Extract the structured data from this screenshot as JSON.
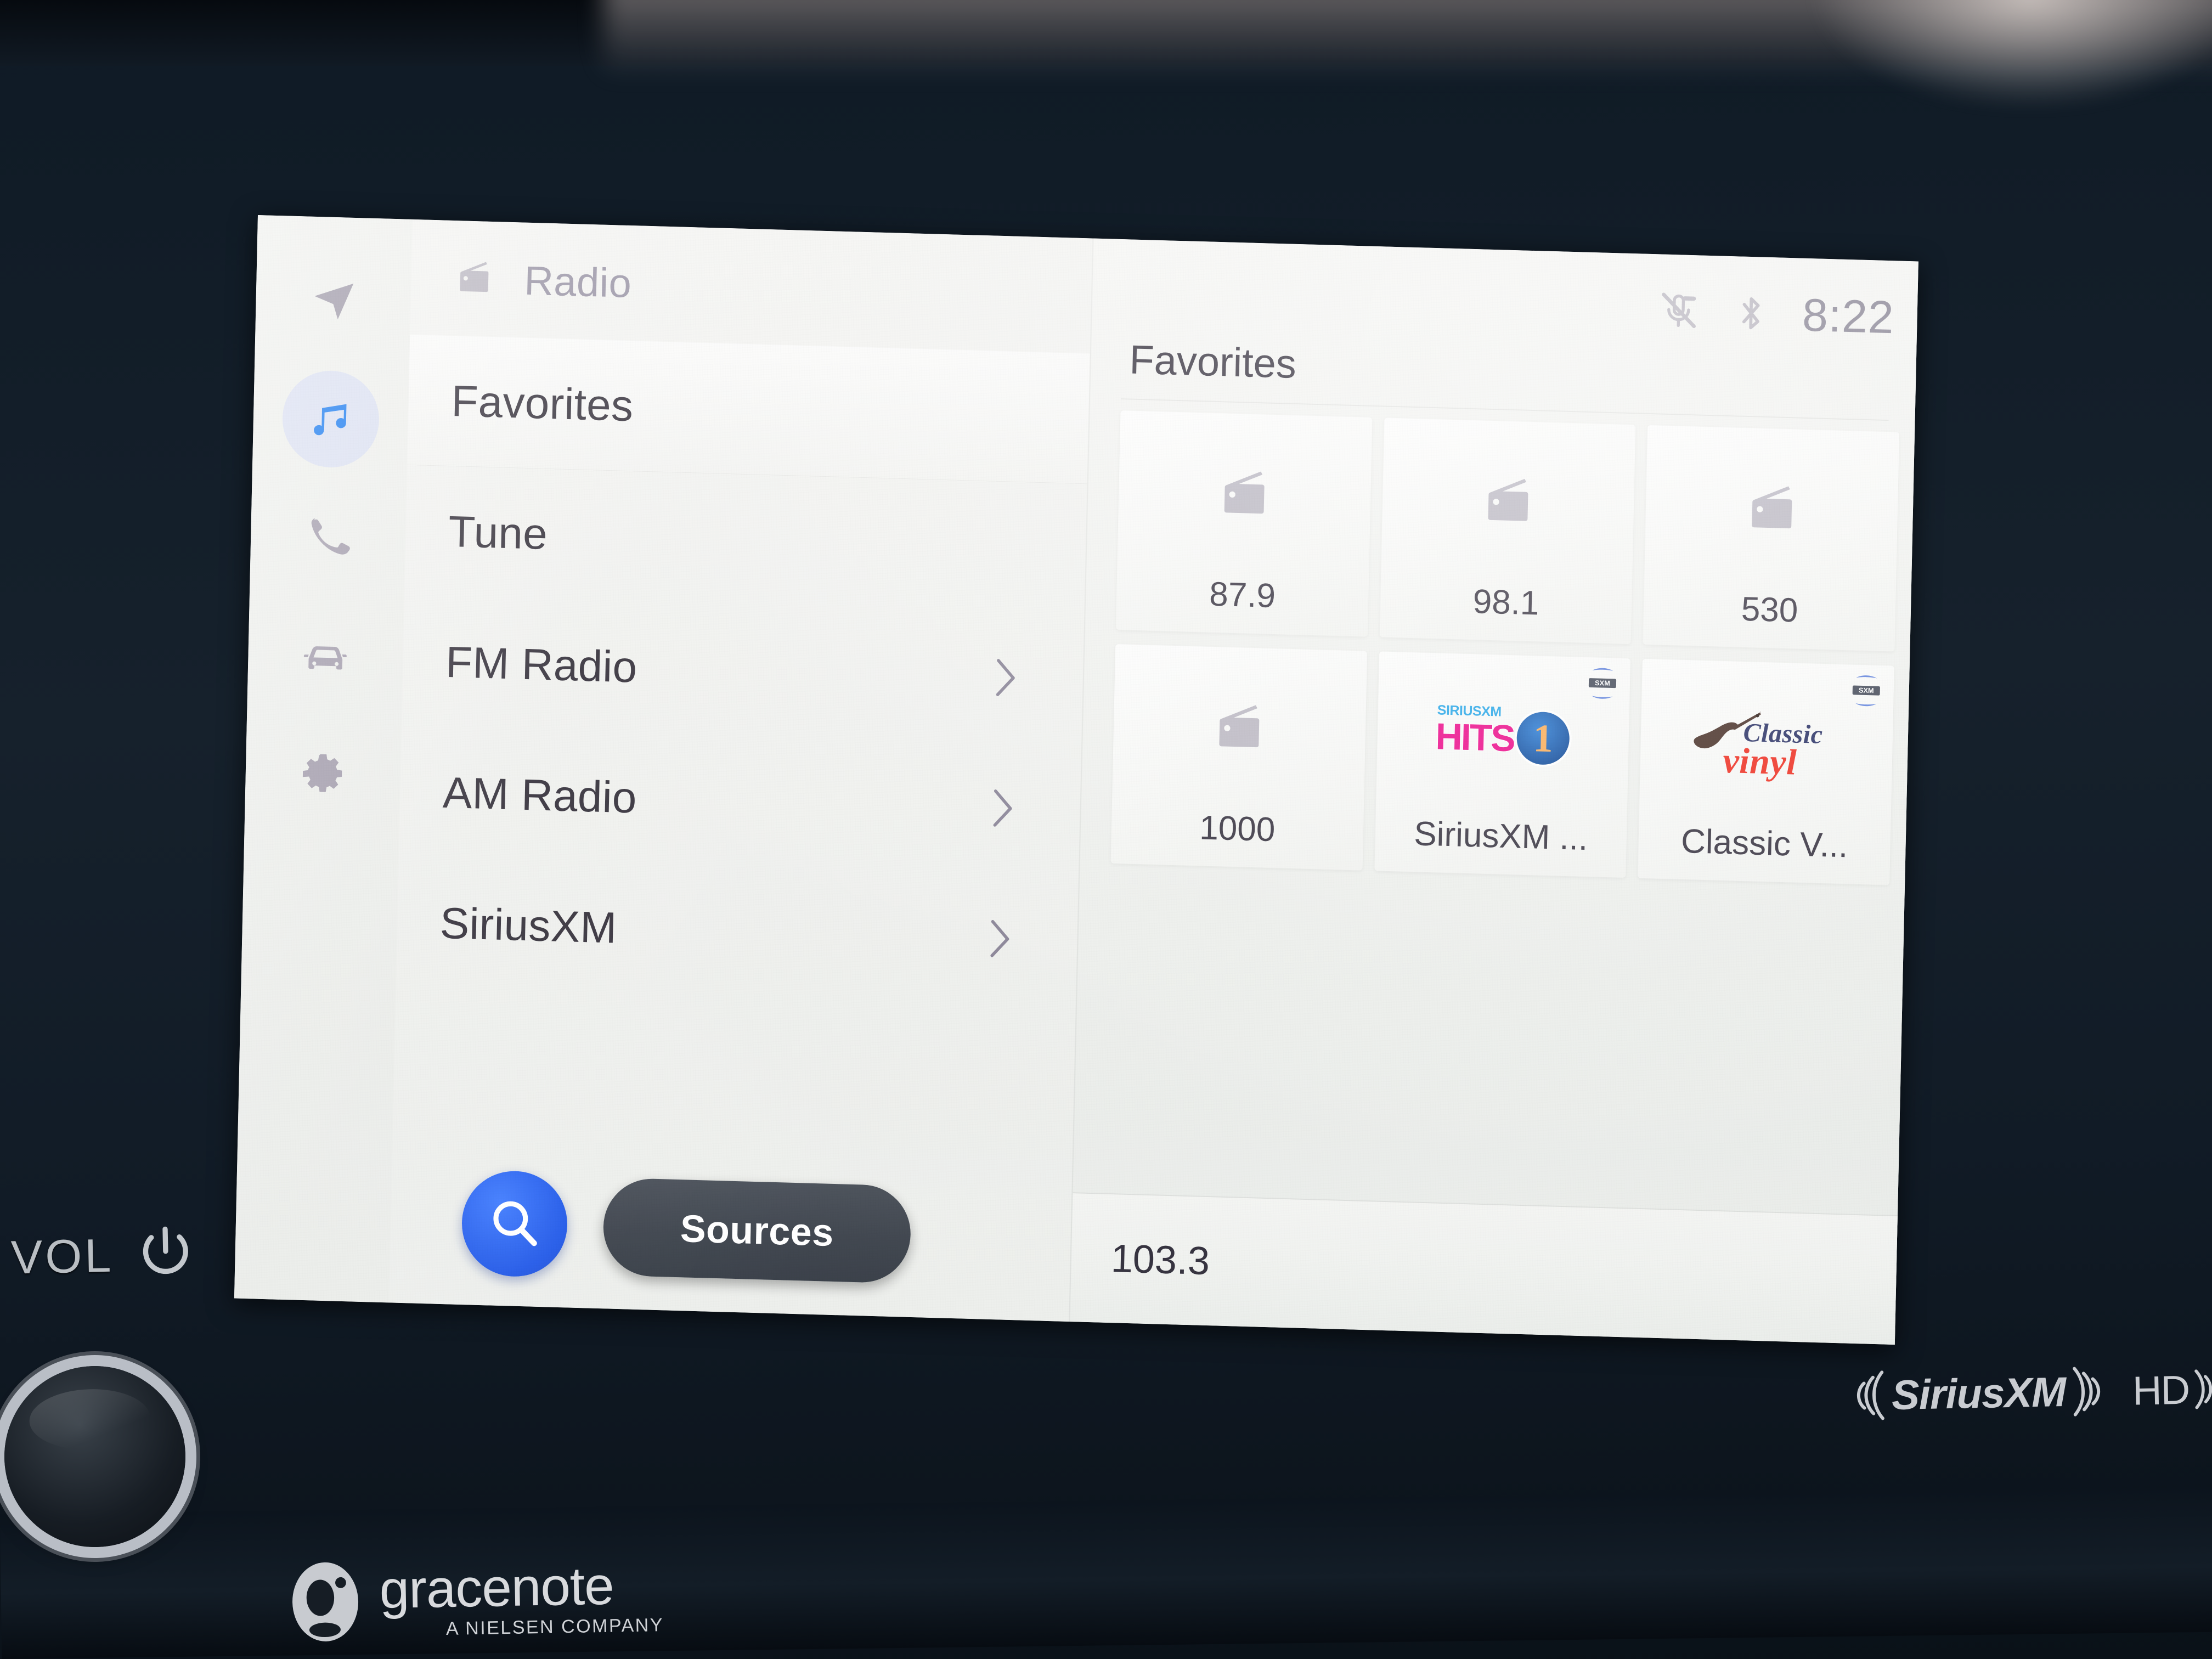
{
  "device": {
    "hardware_labels": {
      "volume": "VOL",
      "power_icon": "power-icon",
      "volume_knob": "volume-knob"
    },
    "branding": {
      "gracenote_name": "gracenote",
      "gracenote_tagline": "A NIELSEN COMPANY",
      "siriusxm_brand": "SiriusXM",
      "hd_radio_brand": "HD"
    }
  },
  "rail": {
    "items": [
      {
        "name": "navigation",
        "icon": "navigation-arrow-icon",
        "selected": false
      },
      {
        "name": "media",
        "icon": "music-note-icon",
        "selected": true
      },
      {
        "name": "phone",
        "icon": "phone-icon",
        "selected": false
      },
      {
        "name": "vehicle",
        "icon": "car-icon",
        "selected": false
      },
      {
        "name": "settings",
        "icon": "gear-icon",
        "selected": false
      }
    ],
    "accent_color": "#1e56e8",
    "selected_pill_color": "#d9dff2"
  },
  "list_panel": {
    "header": {
      "icon": "radio-icon",
      "title": "Radio"
    },
    "items": [
      {
        "label": "Favorites",
        "selected": true,
        "chevron": false
      },
      {
        "label": "Tune",
        "selected": false,
        "chevron": false
      },
      {
        "label": "FM Radio",
        "selected": false,
        "chevron": true
      },
      {
        "label": "AM Radio",
        "selected": false,
        "chevron": true
      },
      {
        "label": "SiriusXM",
        "selected": false,
        "chevron": true
      }
    ],
    "actions": {
      "search_icon": "search-icon",
      "sources_label": "Sources"
    }
  },
  "status_bar": {
    "icons": [
      "microphone-muted-icon",
      "bluetooth-icon"
    ],
    "time": "8:22"
  },
  "content_panel": {
    "title": "Favorites",
    "tiles": [
      {
        "label": "87.9",
        "art": "radio-icon",
        "badge": false
      },
      {
        "label": "98.1",
        "art": "radio-icon",
        "badge": false
      },
      {
        "label": "530",
        "art": "radio-icon",
        "badge": false
      },
      {
        "label": "1000",
        "art": "radio-icon",
        "badge": false
      },
      {
        "label": "SiriusXM ...",
        "art": "siriusxm-hits1-logo",
        "badge": true,
        "logo": {
          "top_text": "SIRIUSXM",
          "main_text": "HITS",
          "circle_text": "1",
          "top_color": "#2aa8e8",
          "main_color": "#ec0f8c",
          "circle_bg": "#15509f",
          "circle_fg": "#f9ae5b"
        }
      },
      {
        "label": "Classic V...",
        "art": "classic-vinyl-logo",
        "badge": true,
        "logo": {
          "word1": "Classic",
          "word2": "vinyl",
          "word1_color": "#2c3467",
          "word2_color": "#ee3124",
          "guitar_color": "#4a322a"
        }
      }
    ],
    "now_playing": "103.3"
  },
  "colors": {
    "screen_bg": "#eceeeb",
    "text_primary": "#3b3741",
    "text_muted": "#9a95a6",
    "accent_blue": "#1e56e8",
    "sources_dark": "#3b414a",
    "bezel": "#0d1620"
  }
}
